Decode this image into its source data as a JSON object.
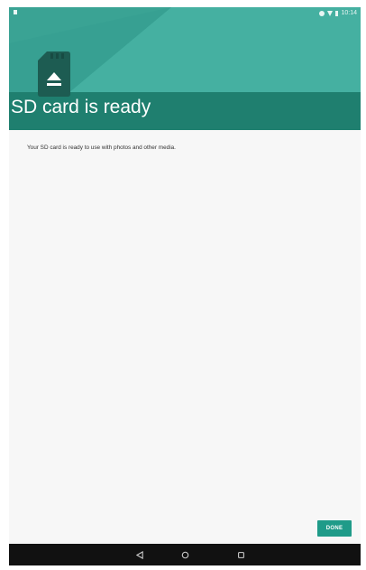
{
  "status_bar": {
    "time": "10:14",
    "icons": [
      "notification-icon",
      "alarm-icon",
      "wifi-icon",
      "battery-icon"
    ]
  },
  "header": {
    "title": "SD card is ready",
    "icon": "sd-card-eject-icon",
    "colors": {
      "primary": "#3aa394",
      "dark": "#1f7f6f"
    }
  },
  "content": {
    "message": "Your SD card is ready to use with photos and other media."
  },
  "actions": {
    "done_label": "DONE",
    "done_color": "#1f9b89"
  },
  "nav_bar": {
    "buttons": [
      "back-icon",
      "home-icon",
      "recents-icon"
    ]
  }
}
